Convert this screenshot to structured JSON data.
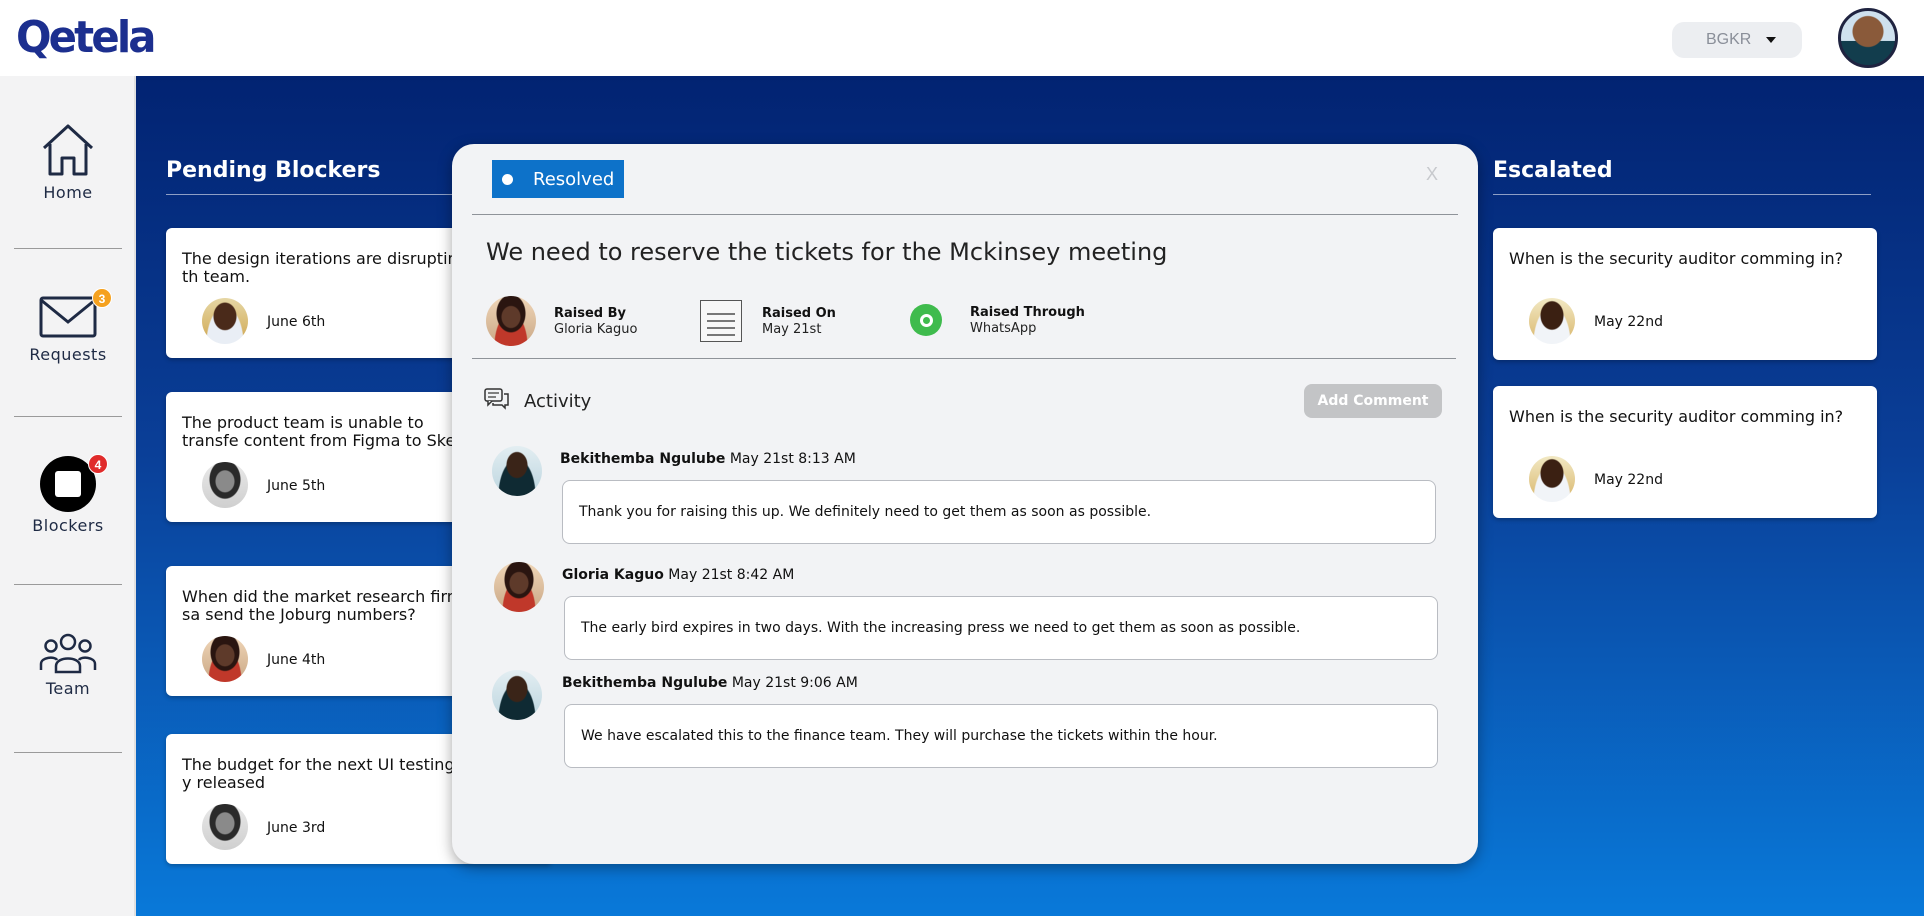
{
  "app": {
    "logo": "Qetela",
    "org_select": "BGKR"
  },
  "sidebar": {
    "items": [
      {
        "label": "Home",
        "icon": "home-icon"
      },
      {
        "label": "Requests",
        "icon": "mail-icon",
        "badge": "3"
      },
      {
        "label": "Blockers",
        "icon": "blocker-icon",
        "badge": "4"
      },
      {
        "label": "Team",
        "icon": "team-icon"
      }
    ]
  },
  "pending": {
    "title": "Pending Blockers",
    "cards": [
      {
        "text": "The design iterations are disrupting th team.",
        "date": "June 6th"
      },
      {
        "text": "The product team is unable to transfe content from Figma to Sketch",
        "date": "June 5th"
      },
      {
        "text": "When did the market research firm sa send the Joburg numbers?",
        "date": "June 4th"
      },
      {
        "text": "The budget for the next UI testing is y released",
        "date": "June 3rd"
      }
    ]
  },
  "escalated": {
    "title": "Escalated",
    "cards": [
      {
        "text": "When is the security auditor comming in?",
        "date": "May 22nd"
      },
      {
        "text": "When is the security auditor comming in?",
        "date": "May 22nd"
      }
    ]
  },
  "modal": {
    "status": "Resolved",
    "close": "X",
    "title": "We need to reserve the tickets for the Mckinsey meeting",
    "raised_by": {
      "label": "Raised By",
      "value": "Gloria Kaguo"
    },
    "raised_on": {
      "label": "Raised On",
      "value": "May 21st"
    },
    "raised_through": {
      "label": "Raised Through",
      "value": "WhatsApp"
    },
    "activity_label": "Activity",
    "add_comment": "Add Comment",
    "comments": [
      {
        "author": "Bekithemba Ngulube",
        "time": "May 21st 8:13 AM",
        "text": "Thank you for raising this up. We definitely need to get them as soon as possible."
      },
      {
        "author": "Gloria Kaguo",
        "time": "May 21st 8:42 AM",
        "text": "The early bird expires in two days. With the increasing press we need to get them as soon as possible."
      },
      {
        "author": "Bekithemba Ngulube",
        "time": "May 21st 9:06 AM",
        "text": "We have escalated this to the finance team. They will purchase the tickets within the hour."
      }
    ]
  },
  "colors": {
    "brand": "#1c2f8f",
    "status_blue": "#0d72c9",
    "badge_orange": "#f5a11e",
    "badge_red": "#e02b2b",
    "whatsapp_green": "#3fbb4d"
  }
}
